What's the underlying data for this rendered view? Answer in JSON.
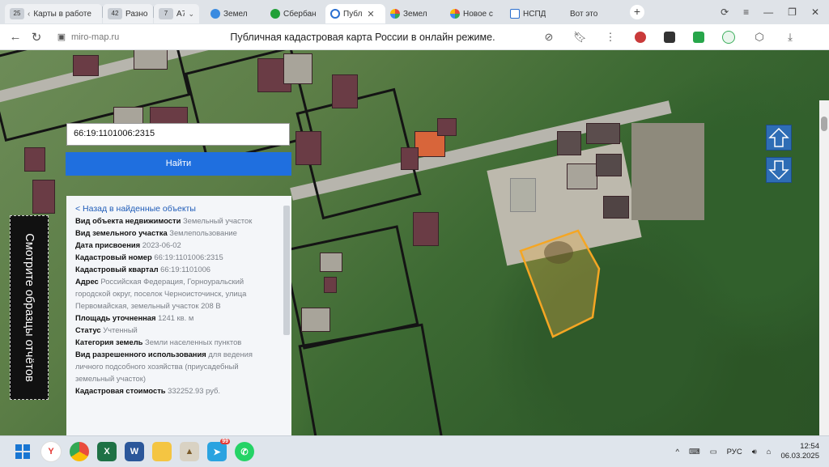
{
  "browser": {
    "tabs": [
      {
        "badge": "25",
        "label": "Карты в работе"
      },
      {
        "badge": "42",
        "label": "Разное"
      },
      {
        "badge": "7",
        "label": "А7"
      },
      {
        "label": "Земел"
      },
      {
        "label": "Сбербан"
      },
      {
        "label": "Публ"
      },
      {
        "label": "Земел"
      },
      {
        "label": "Новое с"
      },
      {
        "label": "НСПД"
      },
      {
        "label": "Вот это"
      }
    ],
    "new_tab": "+",
    "url": "miro-map.ru",
    "page_title": "Публичная кадастровая карта России в онлайн режиме.",
    "colors": {
      "accent": "#1f6fdf",
      "tab_active": "#ffffff"
    }
  },
  "map": {
    "search_value": "66:19:1101006:2315",
    "find_label": "Найти",
    "side_banner": "Смотрите образцы отчётов",
    "up_arrow": "arrow-up-icon",
    "down_arrow": "arrow-down-icon",
    "plot_color": "#f5a623"
  },
  "info": {
    "back": "< Назад в найденные объекты",
    "rows": [
      {
        "label": "Вид объекта недвижимости",
        "value": "Земельный участок"
      },
      {
        "label": "Вид земельного участка",
        "value": "Землепользование"
      },
      {
        "label": "Дата присвоения",
        "value": "2023-06-02"
      },
      {
        "label": "Кадастровый номер",
        "value": "66:19:1101006:2315"
      },
      {
        "label": "Кадастровый квартал",
        "value": "66:19:1101006"
      },
      {
        "label": "Адрес",
        "value": "Российская Федерация, Горноуральский городской округ, поселок Черноисточинск, улица Первомайская, земельный участок 208 В"
      },
      {
        "label": "Площадь уточненная",
        "value": "1241 кв. м"
      },
      {
        "label": "Статус",
        "value": "Учтенный"
      },
      {
        "label": "Категория земель",
        "value": "Земли населенных пунктов"
      },
      {
        "label": "Вид разрешенного использования",
        "value": "для ведения личного подсобного хозяйства (приусадебный земельный участок)"
      },
      {
        "label": "Кадастровая стоимость",
        "value": "332252.93 руб."
      }
    ]
  },
  "taskbar": {
    "lang": "РУС",
    "time": "12:54",
    "date": "06.03.2025",
    "telegram_badge": "99"
  }
}
